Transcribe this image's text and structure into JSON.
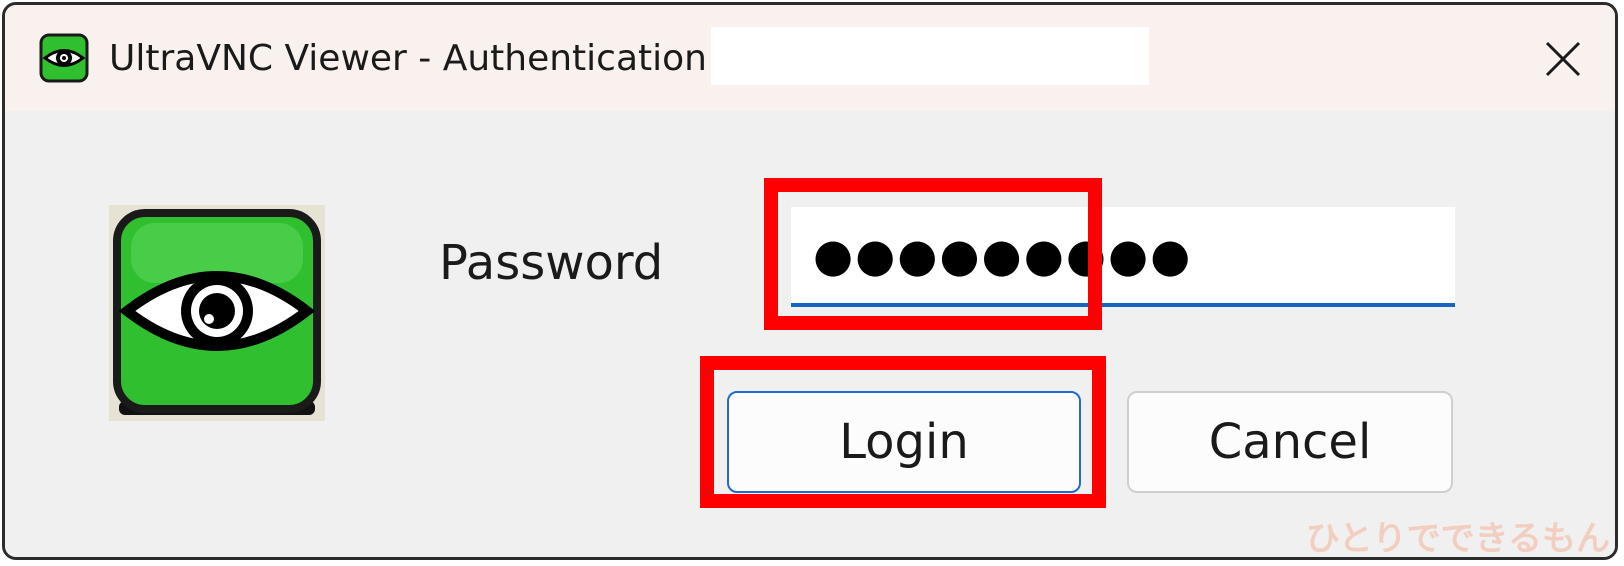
{
  "window": {
    "title": "UltraVNC Viewer - Authentication",
    "close_icon": "close-icon",
    "app_icon": "ultravnc-eye-icon"
  },
  "form": {
    "password_label": "Password",
    "password_value": "●●●●●●●●●",
    "login_label": "Login",
    "cancel_label": "Cancel"
  },
  "watermark": "ひとりでできるもん",
  "colors": {
    "titlebar_bg": "#f8f1ee",
    "dialog_bg": "#f0f0f0",
    "accent": "#1f6bd6",
    "highlight": "#ff0000",
    "logo_green": "#2fbf2f"
  }
}
